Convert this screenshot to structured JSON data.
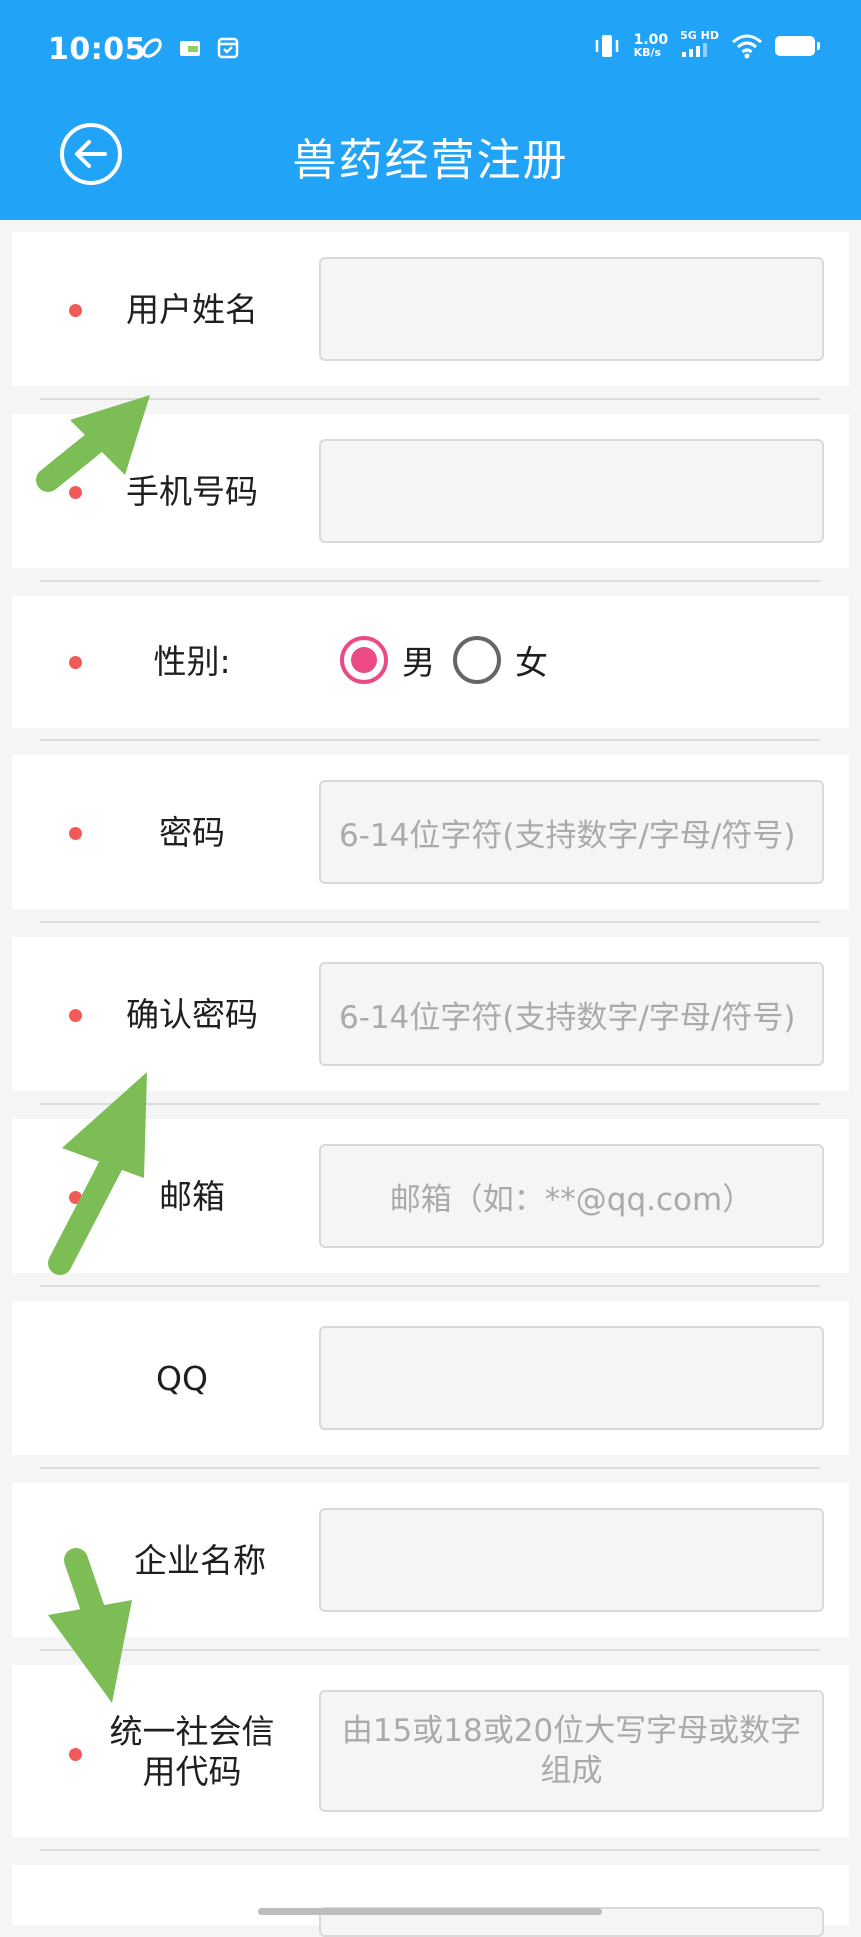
{
  "status_bar": {
    "time": "10:05",
    "net_speed": "1.00",
    "net_unit": "KB/s",
    "network": "5G HD",
    "left_icons": [
      "sync-icon",
      "wallet-icon",
      "calendar-check-icon"
    ],
    "right_icons": [
      "vibrate-icon",
      "signal-icon",
      "wifi-icon",
      "battery-icon"
    ]
  },
  "app_bar": {
    "title": "兽药经营注册",
    "back_icon": "back-arrow-circle-icon"
  },
  "form": {
    "fields": [
      {
        "label": "用户姓名",
        "required": true,
        "value": "",
        "placeholder": ""
      },
      {
        "label": "手机号码",
        "required": true,
        "value": "",
        "placeholder": ""
      },
      {
        "label": "性别:",
        "required": true,
        "type": "radio",
        "options": [
          "男",
          "女"
        ],
        "selected": "男"
      },
      {
        "label": "密码",
        "required": true,
        "value": "",
        "placeholder": "6-14位字符(支持数字/字母/符号)"
      },
      {
        "label": "确认密码",
        "required": true,
        "value": "",
        "placeholder": "6-14位字符(支持数字/字母/符号)"
      },
      {
        "label": "邮箱",
        "required": true,
        "value": "",
        "placeholder": "邮箱（如：**@qq.com）"
      },
      {
        "label": "QQ",
        "required": false,
        "value": "",
        "placeholder": ""
      },
      {
        "label": "企业名称",
        "required": true,
        "value": "",
        "placeholder": ""
      },
      {
        "label": "统一社会信用代码",
        "required": true,
        "value": "",
        "placeholder": "由15或18或20位大写字母或数字组成"
      }
    ]
  },
  "colors": {
    "primary": "#21a3f7",
    "required_dot": "#f25a5a",
    "radio_selected": "#ec4a86",
    "annotation_arrow": "#7dbd56"
  }
}
